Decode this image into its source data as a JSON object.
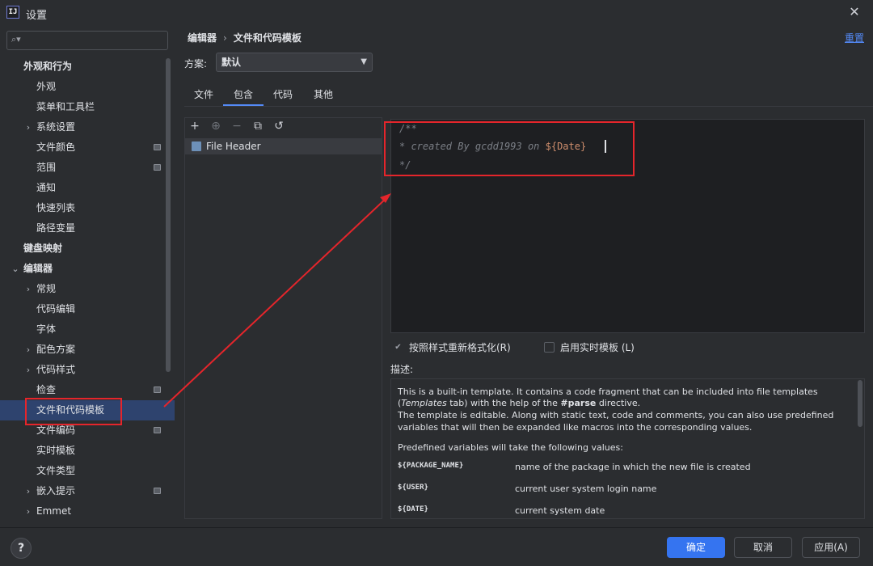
{
  "window": {
    "title": "设置",
    "app_icon_label": "IJ"
  },
  "search": {
    "placeholder": ""
  },
  "sidebar": {
    "items": [
      {
        "label": "外观和行为",
        "level": 0,
        "bold": true
      },
      {
        "label": "外观",
        "level": 1
      },
      {
        "label": "菜单和工具栏",
        "level": 1
      },
      {
        "label": "系统设置",
        "level": 1,
        "collapsed": true
      },
      {
        "label": "文件颜色",
        "level": 1,
        "badge": true
      },
      {
        "label": "范围",
        "level": 1,
        "badge": true
      },
      {
        "label": "通知",
        "level": 1
      },
      {
        "label": "快速列表",
        "level": 1
      },
      {
        "label": "路径变量",
        "level": 1
      },
      {
        "label": "键盘映射",
        "level": 0,
        "bold": true
      },
      {
        "label": "编辑器",
        "level": 0,
        "bold": true,
        "expanded": true
      },
      {
        "label": "常规",
        "level": 1,
        "collapsed": true
      },
      {
        "label": "代码编辑",
        "level": 1
      },
      {
        "label": "字体",
        "level": 1
      },
      {
        "label": "配色方案",
        "level": 1,
        "collapsed": true
      },
      {
        "label": "代码样式",
        "level": 1,
        "collapsed": true
      },
      {
        "label": "检查",
        "level": 1,
        "badge": true
      },
      {
        "label": "文件和代码模板",
        "level": 1,
        "selected": true
      },
      {
        "label": "文件编码",
        "level": 1,
        "badge": true
      },
      {
        "label": "实时模板",
        "level": 1
      },
      {
        "label": "文件类型",
        "level": 1
      },
      {
        "label": "嵌入提示",
        "level": 1,
        "collapsed": true,
        "badge": true
      },
      {
        "label": "Emmet",
        "level": 1,
        "collapsed": true
      }
    ]
  },
  "breadcrumb": {
    "parent": "编辑器",
    "separator": "›",
    "current": "文件和代码模板"
  },
  "reset_label": "重置",
  "scheme": {
    "label": "方案:",
    "value": "默认"
  },
  "tabs": [
    {
      "label": "文件"
    },
    {
      "label": "包含",
      "active": true
    },
    {
      "label": "代码"
    },
    {
      "label": "其他"
    }
  ],
  "toolbar": {
    "add": "+",
    "copy_add": "⊕",
    "remove": "−",
    "duplicate": "⧉",
    "reset": "↺"
  },
  "templates": [
    {
      "label": "File Header"
    }
  ],
  "editor": {
    "line1": "/**",
    "line2_prefix": "* created By gcdd1993 on ",
    "line2_var": "${Date}",
    "line3": "*/"
  },
  "options": {
    "reformat_label": "按照样式重新格式化(R)",
    "reformat_checked": true,
    "live_templates_label": "启用实时模板 (L)",
    "live_templates_checked": false
  },
  "description": {
    "label": "描述:",
    "p1_a": "This is a built-in template. It contains a code fragment that can be included into file templates",
    "p1_b_pre": "(",
    "p1_b_italic": "Templates",
    "p1_b_mid": " tab) with the help of the ",
    "p1_b_bold": "#parse",
    "p1_b_post": " directive.",
    "p2_a": "The template is editable. Along with static text, code and comments, you can also use predefined",
    "p2_b": "variables that will then be expanded like macros into the corresponding values.",
    "p3": "Predefined variables will take the following values:",
    "vars": [
      {
        "name": "${PACKAGE_NAME}",
        "desc": "name of the package in which the new file is created"
      },
      {
        "name": "${USER}",
        "desc": "current user system login name"
      },
      {
        "name": "${DATE}",
        "desc": "current system date"
      }
    ]
  },
  "footer": {
    "help": "?",
    "ok": "确定",
    "cancel": "取消",
    "apply": "应用(A)"
  }
}
